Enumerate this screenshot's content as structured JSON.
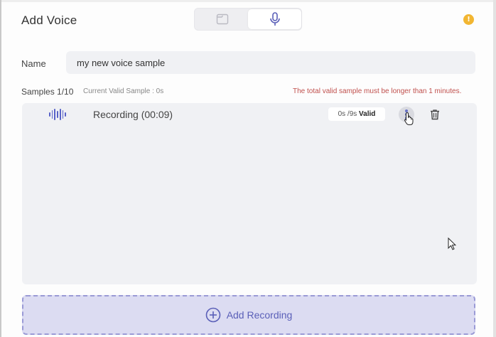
{
  "dialog": {
    "title": "Add Voice",
    "mode_switch": {
      "options": [
        "file-icon",
        "microphone-icon"
      ],
      "active": "microphone"
    },
    "info_icon": "info-icon",
    "info_glyph": "!"
  },
  "name_field": {
    "label": "Name",
    "value": "my new voice sample"
  },
  "samples": {
    "label": "Samples 1/10",
    "current_valid": "Current Valid Sample : 0s",
    "warning": "The total valid sample must be longer than 1 minutes.",
    "items": [
      {
        "name": "Recording (00:09)",
        "valid_prefix": "0s /9s",
        "valid_word": "Valid",
        "icon": "waveform-icon"
      }
    ]
  },
  "add_recording": {
    "label": "Add Recording",
    "icon": "plus-circle-icon"
  },
  "colors": {
    "accent": "#5a5fb8",
    "warning": "#c0504d",
    "info": "#f2b632"
  }
}
